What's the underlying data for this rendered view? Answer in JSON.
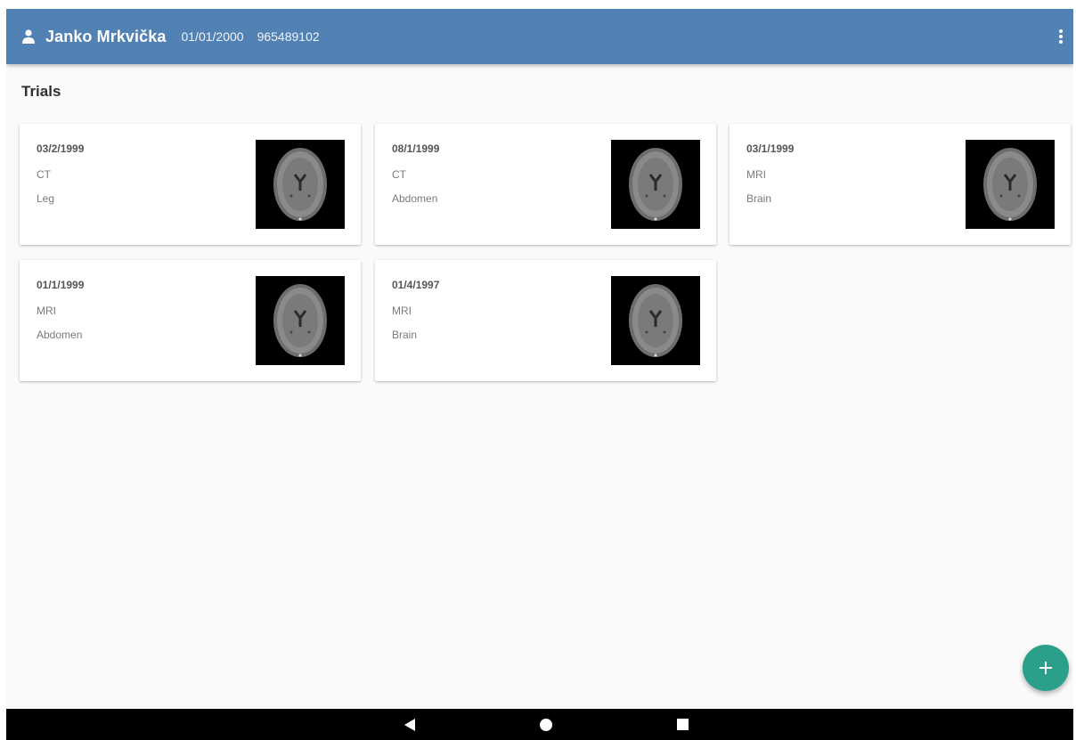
{
  "appbar": {
    "icon": "person-icon",
    "name": "Janko Mrkvička",
    "dob": "01/01/2000",
    "id": "965489102",
    "menu_icon": "more-vert-icon"
  },
  "section": {
    "title": "Trials"
  },
  "trials": [
    {
      "date": "03/2/1999",
      "modality": "CT",
      "region": "Leg",
      "thumbnail": "brain-mri-thumbnail"
    },
    {
      "date": "08/1/1999",
      "modality": "CT",
      "region": "Abdomen",
      "thumbnail": "brain-mri-thumbnail"
    },
    {
      "date": "03/1/1999",
      "modality": "MRI",
      "region": "Brain",
      "thumbnail": "brain-mri-thumbnail"
    },
    {
      "date": "01/1/1999",
      "modality": "MRI",
      "region": "Abdomen",
      "thumbnail": "brain-mri-thumbnail"
    },
    {
      "date": "01/4/1997",
      "modality": "MRI",
      "region": "Brain",
      "thumbnail": "brain-mri-thumbnail"
    }
  ],
  "fab": {
    "icon": "plus-icon"
  },
  "navbar": {
    "back_icon": "back-triangle-icon",
    "home_icon": "home-circle-icon",
    "recents_icon": "recents-square-icon"
  },
  "colors": {
    "appbar": "#5281b3",
    "fab": "#2aa08a",
    "background": "#fafafa"
  }
}
